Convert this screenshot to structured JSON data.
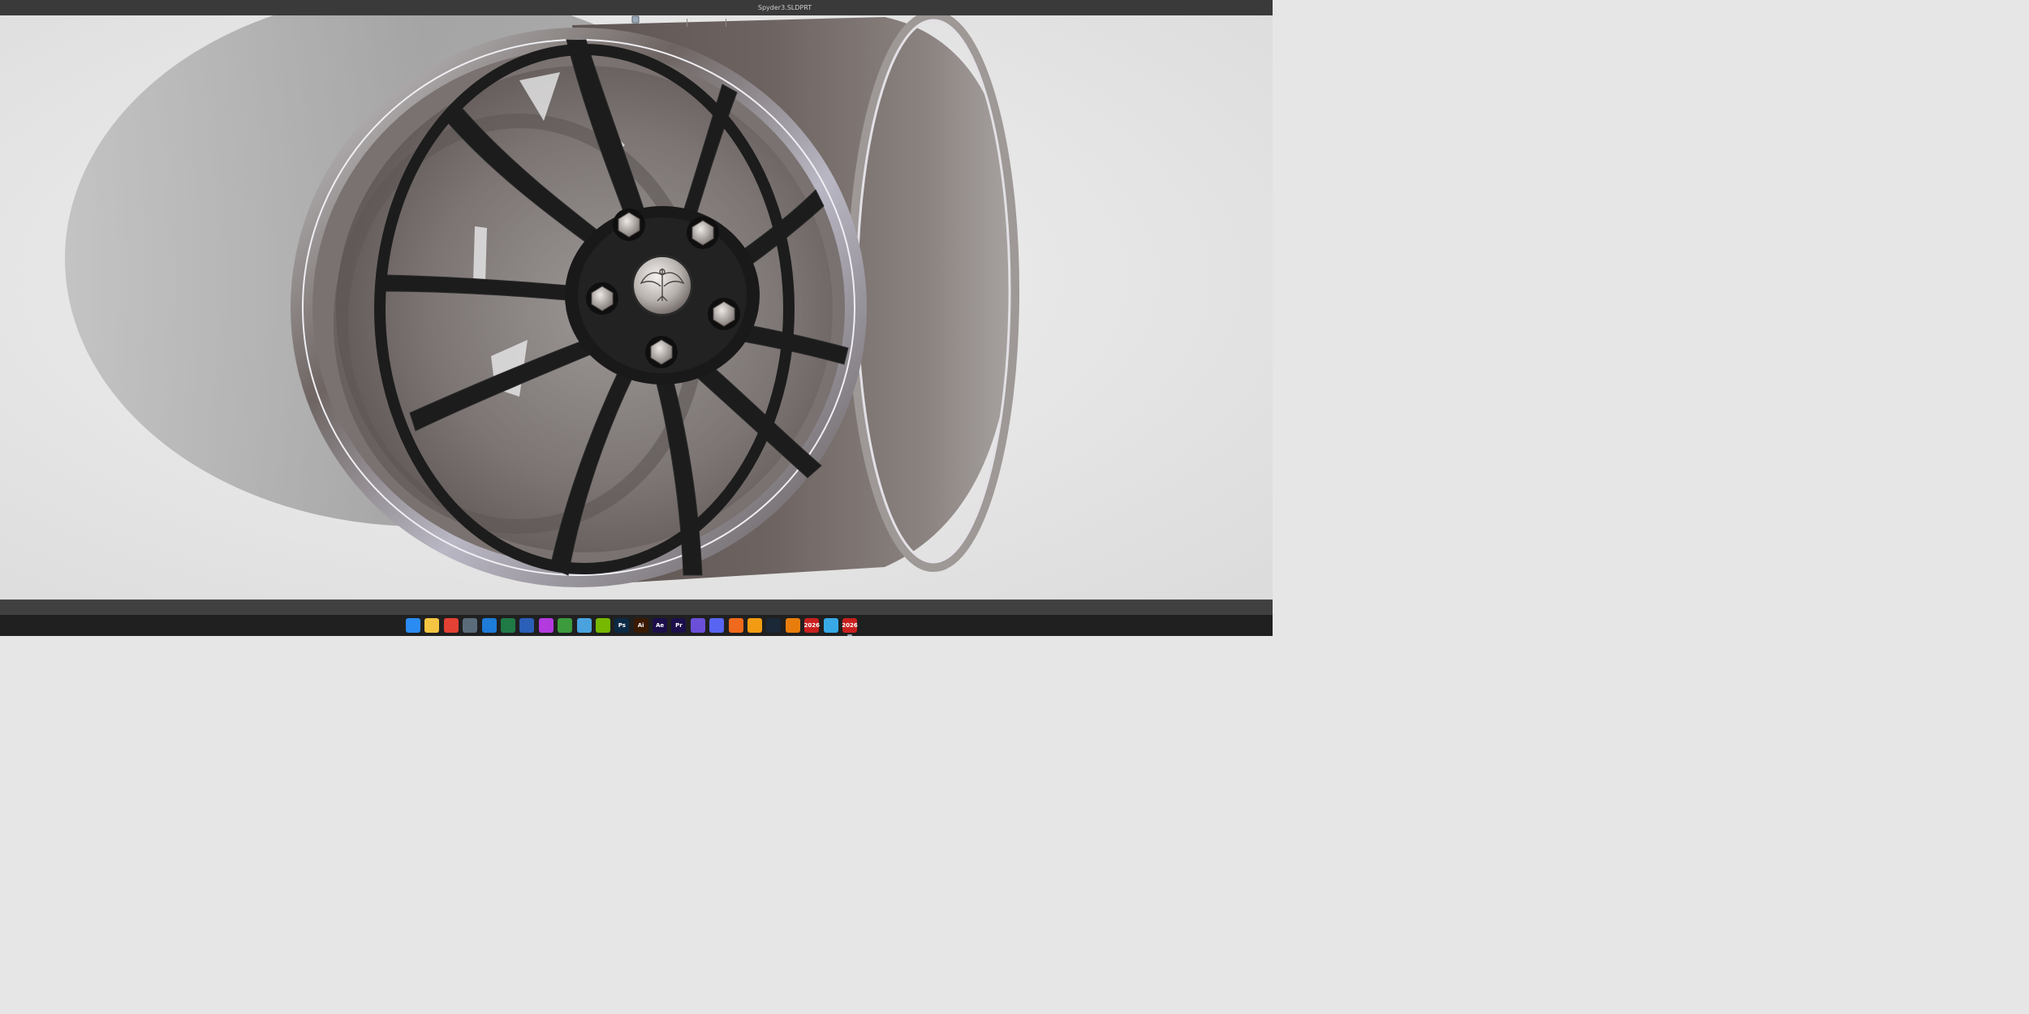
{
  "window": {
    "title": "Spyder3.SLDPRT"
  },
  "colors": {
    "titlebar_bg": "#3a3a3a",
    "viewport_bg": "#ececec",
    "statusbar_bg": "#404040",
    "taskbar_bg": "#202020",
    "wheel_spoke": "#1c1c1c",
    "wheel_lip": "#7a7270",
    "barrel": "#6e6562",
    "lug_nut": "#c7c1bd"
  },
  "heads_up_toolbar": {
    "tools": [
      {
        "icon": "zoom-to-fit-icon"
      },
      {
        "icon": "zoom-to-area-icon"
      },
      {
        "icon": "previous-view-icon"
      },
      {
        "icon": "section-view-icon"
      },
      {
        "icon": "view-orientation-icon"
      },
      {
        "icon": "display-style-icon"
      },
      {
        "icon": "hide-show-items-icon"
      },
      {
        "icon": "edit-appearance-icon"
      },
      {
        "icon": "apply-scene-icon"
      },
      {
        "icon": "view-settings-icon"
      }
    ]
  },
  "taskbar": {
    "apps": [
      {
        "icon": "windows-start-icon",
        "label": "",
        "color": "#2a8bf2"
      },
      {
        "icon": "file-explorer-icon",
        "label": "",
        "color": "#f5c542"
      },
      {
        "icon": "chrome-icon",
        "label": "",
        "color": "#e34133"
      },
      {
        "icon": "calculator-icon",
        "label": "",
        "color": "#5a6b7a"
      },
      {
        "icon": "calendar-icon",
        "label": "",
        "color": "#1e7bd8"
      },
      {
        "icon": "excel-icon",
        "label": "",
        "color": "#1f7a45"
      },
      {
        "icon": "word-icon",
        "label": "",
        "color": "#2b5fb8"
      },
      {
        "icon": "messenger-icon",
        "label": "",
        "color": "#b23adf"
      },
      {
        "icon": "xbox-icon",
        "label": "",
        "color": "#3c9b3c"
      },
      {
        "icon": "notepad-icon",
        "label": "",
        "color": "#4aa3df"
      },
      {
        "icon": "nvidia-icon",
        "label": "",
        "color": "#76b900"
      },
      {
        "icon": "photoshop-icon",
        "label": "Ps",
        "color": "#0b2a45"
      },
      {
        "icon": "illustrator-icon",
        "label": "Ai",
        "color": "#3a1a00"
      },
      {
        "icon": "after-effects-icon",
        "label": "Ae",
        "color": "#1c0f4a"
      },
      {
        "icon": "premiere-icon",
        "label": "Pr",
        "color": "#1c0f4a"
      },
      {
        "icon": "task-manager-icon",
        "label": "",
        "color": "#6b4fd8"
      },
      {
        "icon": "discord-icon",
        "label": "",
        "color": "#5865f2"
      },
      {
        "icon": "origin-icon",
        "label": "",
        "color": "#f06a1d"
      },
      {
        "icon": "fusion-icon",
        "label": "",
        "color": "#f39c12"
      },
      {
        "icon": "steam-icon",
        "label": "",
        "color": "#1b2838"
      },
      {
        "icon": "blender-icon",
        "label": "",
        "color": "#e87d0d"
      },
      {
        "icon": "solidworks-2026-icon",
        "label": "2026",
        "color": "#c9201f"
      },
      {
        "icon": "cube-app-icon",
        "label": "",
        "color": "#38a9e6"
      },
      {
        "icon": "solidworks-2026-active-icon",
        "label": "2026",
        "color": "#c9201f"
      }
    ]
  }
}
